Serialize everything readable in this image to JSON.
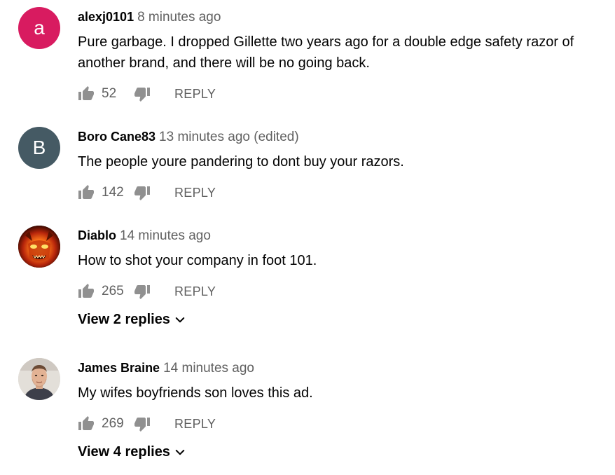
{
  "comments": [
    {
      "avatar_letter": "a",
      "avatar_color": "#d81b60",
      "author": "alexj0101",
      "time": "8 minutes ago",
      "text": "Pure garbage.  I dropped Gillette two years ago for a double edge safety razor of another brand, and there will be no going back.",
      "likes": "52",
      "reply_label": "REPLY"
    },
    {
      "avatar_letter": "B",
      "avatar_color": "#455a64",
      "author": "Boro Cane83",
      "time": "13 minutes ago (edited)",
      "text": "The people youre pandering to dont buy your razors.",
      "likes": "142",
      "reply_label": "REPLY"
    },
    {
      "avatar_icon": "demon-face-avatar",
      "author": "Diablo",
      "time": "14 minutes ago",
      "text": "How to shot your company in foot 101.",
      "likes": "265",
      "reply_label": "REPLY",
      "view_replies": "View 2 replies"
    },
    {
      "avatar_icon": "man-photo-avatar",
      "author": "James Braine",
      "time": "14 minutes ago",
      "text": "My wifes boyfriends son loves this ad.",
      "likes": "269",
      "reply_label": "REPLY",
      "view_replies": "View 4 replies"
    }
  ],
  "colors": {
    "text_primary": "#030303",
    "text_secondary": "#606060",
    "icon": "#909090"
  }
}
